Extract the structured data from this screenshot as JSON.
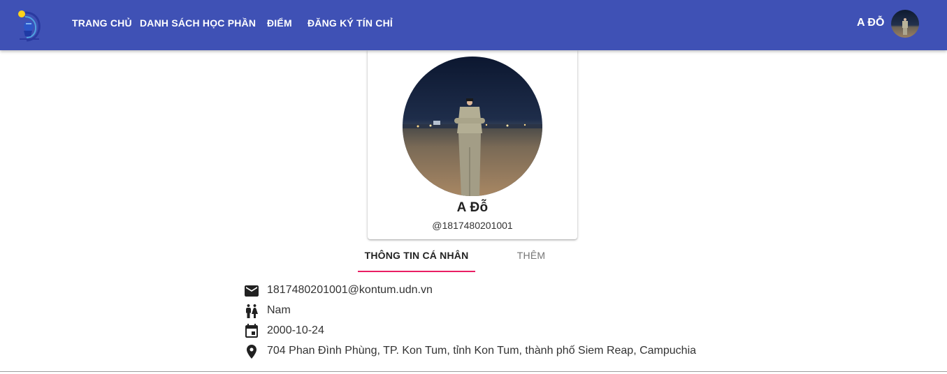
{
  "header": {
    "nav": [
      {
        "label": "TRANG CHỦ"
      },
      {
        "label": "DANH SÁCH HỌC PHẦN"
      },
      {
        "label": "ĐIỂM"
      },
      {
        "label": "ĐĂNG KÝ TÍN CHỈ"
      }
    ],
    "user_name": "A ĐỖ",
    "colors": {
      "appbar": "#3f51b5",
      "text": "#ffffff"
    }
  },
  "profile": {
    "name": "A Đỗ",
    "handle": "@1817480201001"
  },
  "tabs": [
    {
      "label": "THÔNG TIN CÁ NHÂN",
      "active": true
    },
    {
      "label": "THÊM",
      "active": false
    }
  ],
  "tab_indicator_color": "#e91e63",
  "info": [
    {
      "icon": "email-icon",
      "text": "1817480201001@kontum.udn.vn"
    },
    {
      "icon": "gender-icon",
      "text": "Nam"
    },
    {
      "icon": "calendar-icon",
      "text": "2000-10-24"
    },
    {
      "icon": "location-icon",
      "text": "704 Phan Đình Phùng, TP. Kon Tum, tỉnh Kon Tum, thành phố Siem Reap, Campuchia"
    }
  ]
}
